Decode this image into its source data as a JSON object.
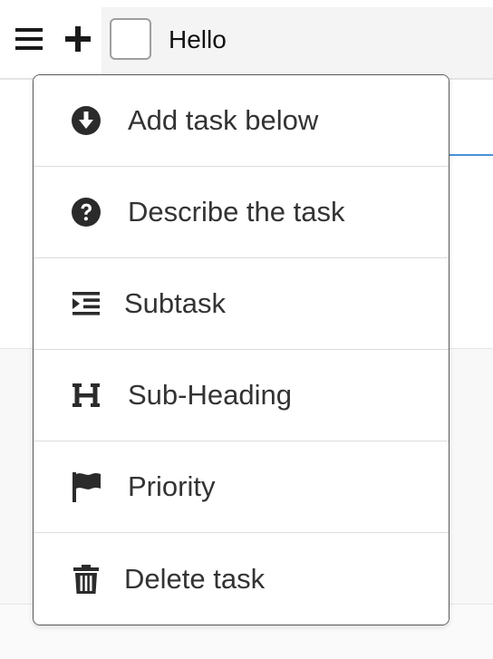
{
  "header": {
    "task_title": "Hello"
  },
  "context_menu": {
    "items": [
      {
        "label": "Add task below",
        "icon": "arrow-circle-down-icon"
      },
      {
        "label": "Describe the task",
        "icon": "question-circle-icon"
      },
      {
        "label": "Subtask",
        "icon": "indent-icon"
      },
      {
        "label": "Sub-Heading",
        "icon": "heading-icon"
      },
      {
        "label": "Priority",
        "icon": "flag-icon"
      },
      {
        "label": "Delete task",
        "icon": "trash-icon"
      }
    ]
  },
  "colors": {
    "text": "#333333",
    "icon": "#2b2b2b",
    "menu_border": "#5a5a5a",
    "divider": "#dcdcdc",
    "accent_line": "#4a90d9"
  }
}
